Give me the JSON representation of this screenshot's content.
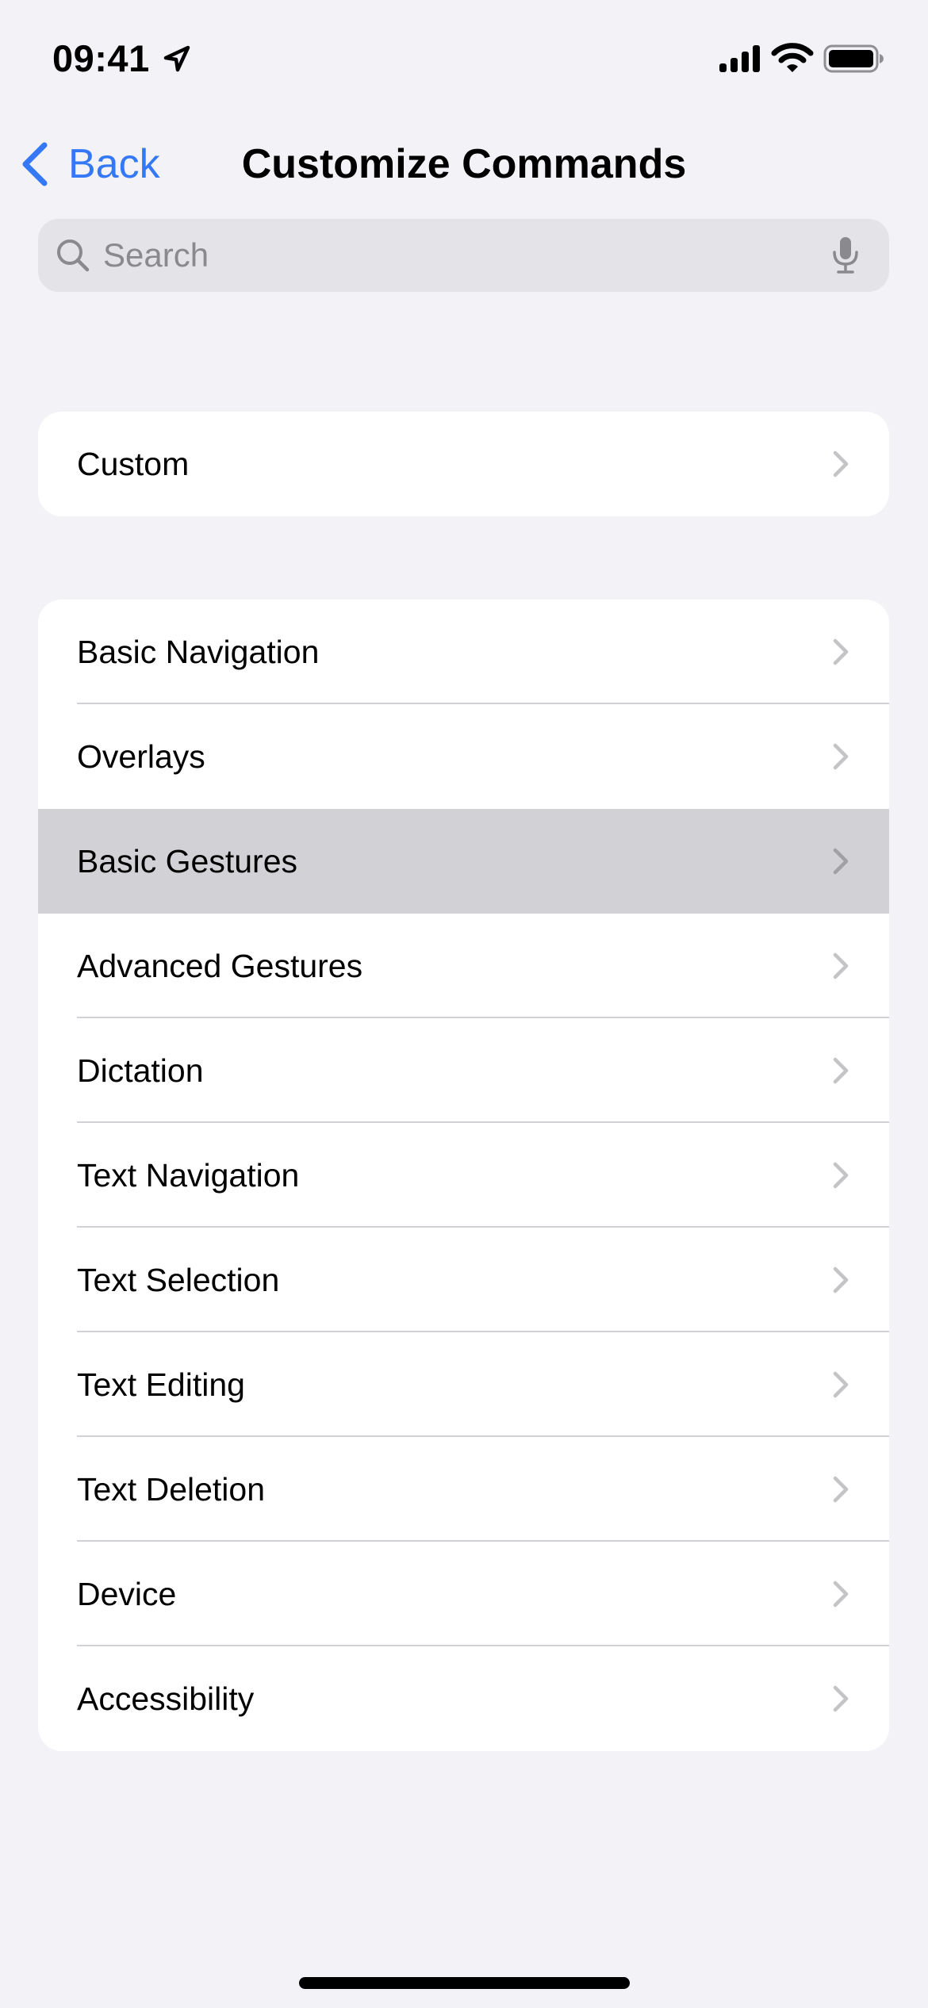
{
  "status_bar": {
    "time": "09:41",
    "icons": [
      "location-arrow-icon",
      "cellular-signal-icon",
      "wifi-icon",
      "battery-icon"
    ]
  },
  "nav": {
    "back_label": "Back",
    "title": "Customize Commands"
  },
  "search": {
    "placeholder": "Search",
    "value": ""
  },
  "colors": {
    "accent": "#3478f6",
    "background": "#f2f2f7",
    "card": "#ffffff",
    "highlight": "#d1d1d6",
    "chevron": "#c4c4c7",
    "placeholder": "#8a8a8e"
  },
  "sections": [
    {
      "items": [
        {
          "label": "Custom",
          "highlighted": false
        }
      ]
    },
    {
      "items": [
        {
          "label": "Basic Navigation",
          "highlighted": false
        },
        {
          "label": "Overlays",
          "highlighted": false
        },
        {
          "label": "Basic Gestures",
          "highlighted": true
        },
        {
          "label": "Advanced Gestures",
          "highlighted": false
        },
        {
          "label": "Dictation",
          "highlighted": false
        },
        {
          "label": "Text Navigation",
          "highlighted": false
        },
        {
          "label": "Text Selection",
          "highlighted": false
        },
        {
          "label": "Text Editing",
          "highlighted": false
        },
        {
          "label": "Text Deletion",
          "highlighted": false
        },
        {
          "label": "Device",
          "highlighted": false
        },
        {
          "label": "Accessibility",
          "highlighted": false
        }
      ]
    }
  ]
}
